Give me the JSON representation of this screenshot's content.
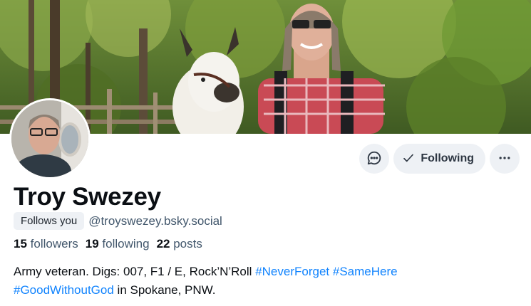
{
  "profile": {
    "display_name": "Troy Swezey",
    "follows_you_badge": "Follows you",
    "handle": "@troyswezey.bsky.social",
    "stats": {
      "followers_count": "15",
      "followers_label": "followers",
      "following_count": "19",
      "following_label": "following",
      "posts_count": "22",
      "posts_label": "posts"
    },
    "bio": {
      "text_1": "Army veteran. Digs: 007, F1 / E, Rock’N’Roll",
      "tag_1": "#NeverForget",
      "tag_2": "#SameHere",
      "tag_3": "#GoodWithoutGod",
      "text_2": "in Spokane, PNW."
    }
  },
  "actions": {
    "message_icon": "chat-bubble-icon",
    "following_label": "Following",
    "following_icon": "check-icon",
    "more_icon": "more-horizontal-icon"
  },
  "colors": {
    "accent": "#1083fe",
    "button_bg": "#eef1f5",
    "muted_text": "#42576c",
    "text": "#0b0f14"
  }
}
